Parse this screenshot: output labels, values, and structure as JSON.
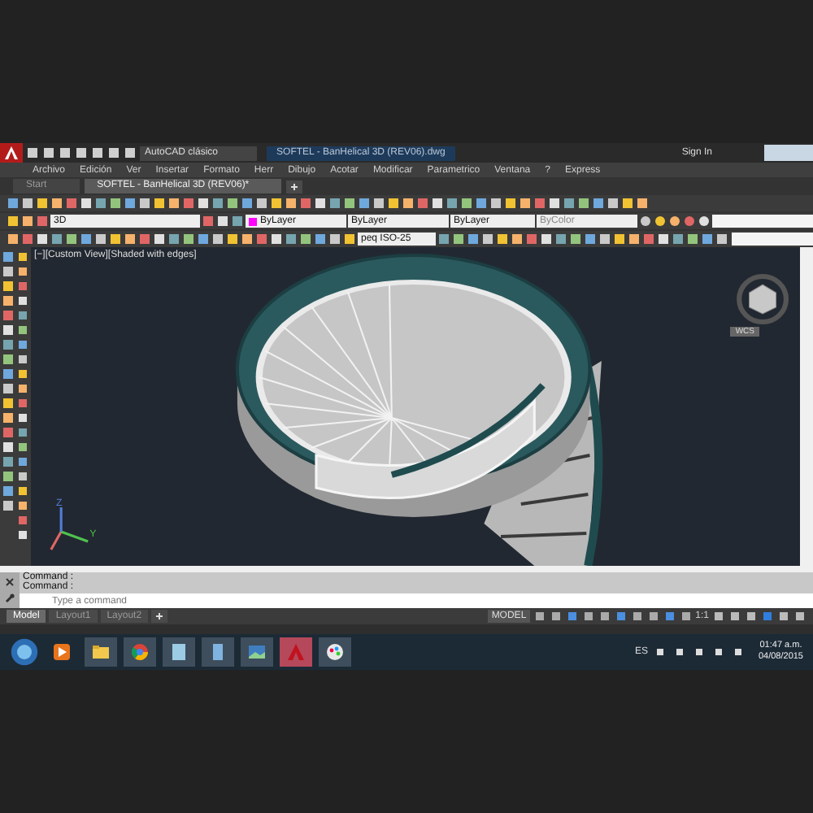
{
  "title_bar": {
    "workspace": "AutoCAD clásico",
    "title": "SOFTEL - BanHelical 3D (REV06).dwg",
    "sign_in": "Sign In"
  },
  "menu": [
    "Archivo",
    "Edición",
    "Ver",
    "Insertar",
    "Formato",
    "Herr",
    "Dibujo",
    "Acotar",
    "Modificar",
    "Parametrico",
    "Ventana",
    "?",
    "Express"
  ],
  "file_tabs": [
    {
      "label": "Start",
      "selected": false
    },
    {
      "label": "SOFTEL - BanHelical 3D (REV06)*",
      "selected": true
    }
  ],
  "properties": {
    "layer": "3D",
    "swatch": {
      "color": "#ff00ff"
    },
    "object_color": "ByLayer",
    "linetype": "ByLayer",
    "lineweight": "ByLayer",
    "plot_style": "ByColor",
    "dim_style": "peq ISO-25"
  },
  "viewport": {
    "label": "[−][Custom View][Shaded with edges]",
    "viewcube_label": "WCS",
    "axis_z": "Z",
    "axis_y": "Y"
  },
  "command_history": [
    "Command :",
    "Command :"
  ],
  "command_input": {
    "placeholder": "Type a command"
  },
  "layout_tabs": [
    {
      "label": "Model",
      "selected": true
    },
    {
      "label": "Layout1",
      "selected": false
    },
    {
      "label": "Layout2",
      "selected": false
    }
  ],
  "status_bar": {
    "mode": "MODEL",
    "scale": "1:1"
  },
  "taskbar": {
    "language": "ES",
    "time": "01:47 a.m.",
    "date": "04/08/2015"
  }
}
